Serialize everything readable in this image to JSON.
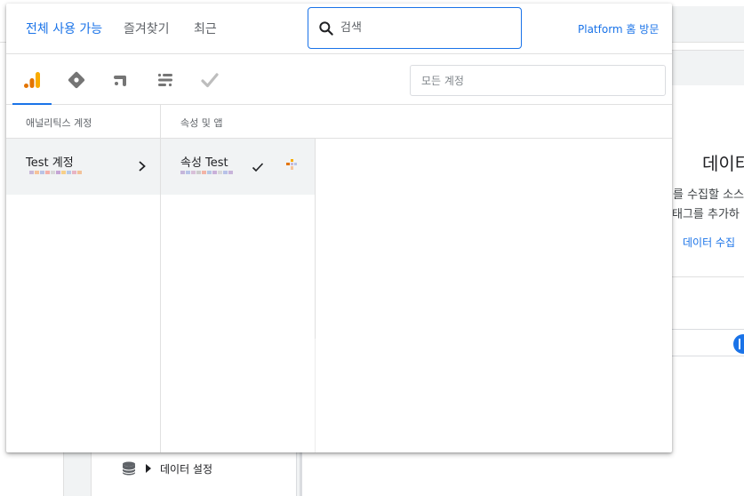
{
  "background": {
    "title": "데이터",
    "line1": "를 수집할 소스",
    "line2": "태그를 추가하",
    "link": "데이터 수집",
    "nav_item": "데이터 설정"
  },
  "tabs": {
    "all": "전체 사용 가능",
    "favorites": "즐겨찾기",
    "recent": "최근"
  },
  "search": {
    "placeholder": "검색"
  },
  "platform_link": "Platform 홈 방문",
  "products": [
    {
      "icon": "google-analytics-icon"
    },
    {
      "icon": "tag-manager-icon"
    },
    {
      "icon": "optimize-icon"
    },
    {
      "icon": "surveys-icon"
    },
    {
      "icon": "data-studio-icon"
    }
  ],
  "account_filter": {
    "placeholder": "모든 계정"
  },
  "columns": {
    "accounts_header": "애널리틱스 계정",
    "properties_header": "속성 및 앱"
  },
  "account": {
    "name": "Test 계정"
  },
  "property": {
    "name": "속성 Test"
  },
  "colors": {
    "accent": "#1a73e8",
    "analytics_orange": "#f9ab00",
    "analytics_dark_orange": "#e37400",
    "selected_row": "#f1f3f4"
  }
}
